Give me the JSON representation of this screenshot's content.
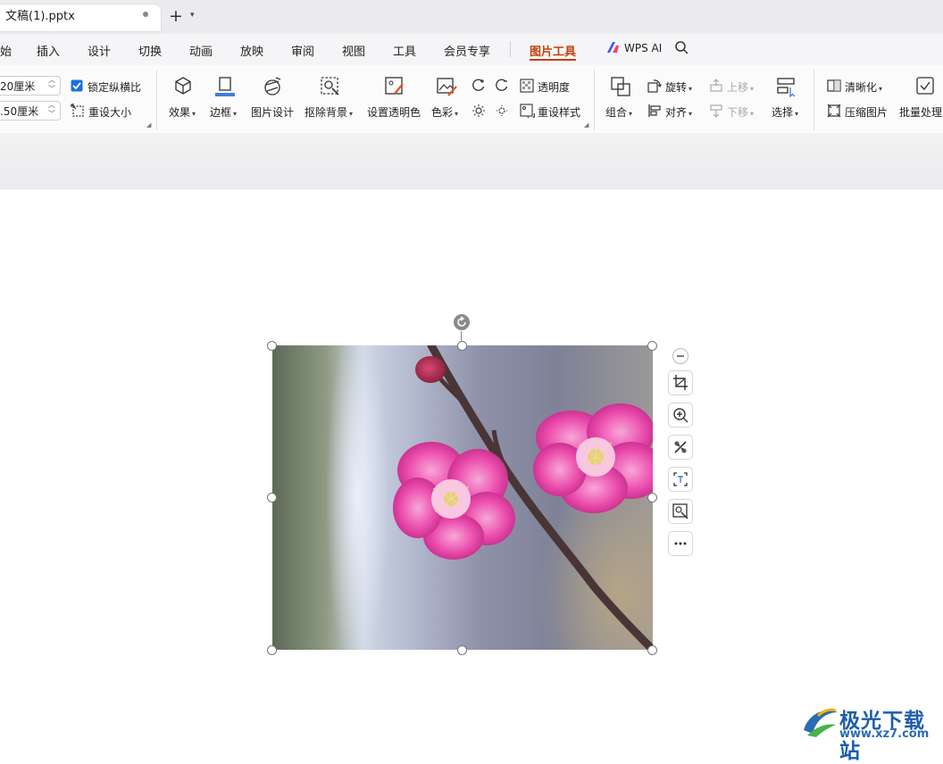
{
  "tab": {
    "title": "文稿(1).pptx"
  },
  "menu": [
    "始",
    "插入",
    "设计",
    "切换",
    "动画",
    "放映",
    "审阅",
    "视图",
    "工具",
    "会员专享",
    "图片工具"
  ],
  "wps_ai": "WPS AI",
  "size": {
    "width": "20厘米",
    "height": ".50厘米",
    "lock_ratio": "锁定纵横比",
    "reset_size": "重设大小"
  },
  "ribbon": {
    "effect": "效果",
    "border": "边框",
    "pic_design": "图片设计",
    "remove_bg": "抠除背景",
    "set_transparent": "设置透明色",
    "color": "色彩",
    "transparency": "透明度",
    "reset_style": "重设样式",
    "group": "组合",
    "rotate": "旋转",
    "align": "对齐",
    "bring_forward": "上移",
    "send_backward": "下移",
    "select": "选择",
    "sharpen": "清晰化",
    "compress": "压缩图片",
    "batch": "批量处理"
  },
  "watermark": {
    "name": "极光下载站",
    "url": "www.xz7.com"
  },
  "colors": {
    "accent": "#c2410c",
    "wps_blue": "#1d5ea8"
  }
}
